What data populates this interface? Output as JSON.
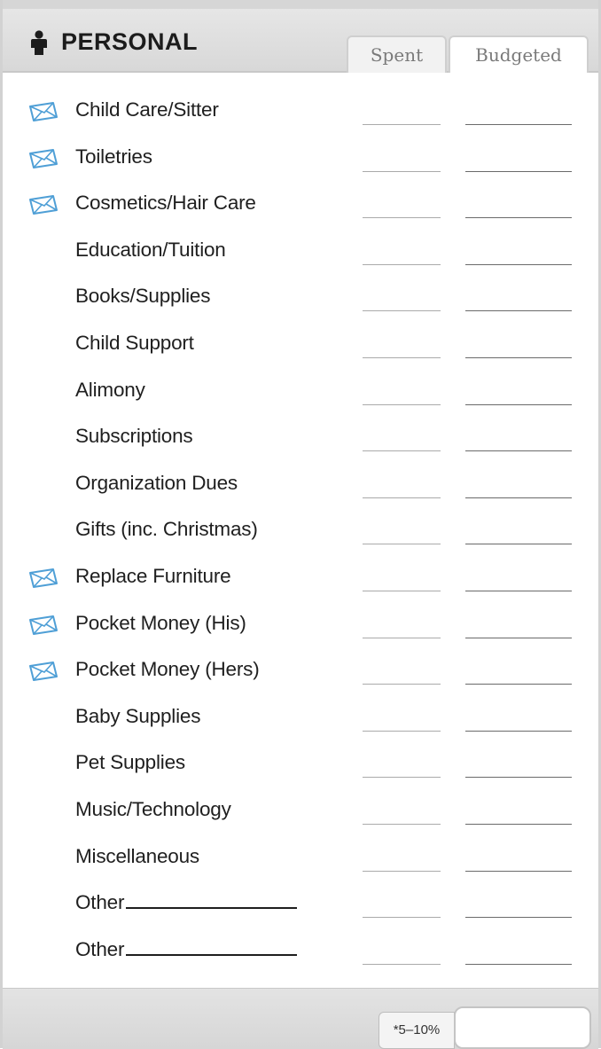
{
  "section": {
    "title": "PERSONAL",
    "icon": "person-icon"
  },
  "tabs": {
    "spent": "Spent",
    "budgeted": "Budgeted"
  },
  "items": [
    {
      "label": "Child Care/Sitter",
      "envelope": true
    },
    {
      "label": "Toiletries",
      "envelope": true
    },
    {
      "label": "Cosmetics/Hair Care",
      "envelope": true
    },
    {
      "label": "Education/Tuition",
      "envelope": false
    },
    {
      "label": "Books/Supplies",
      "envelope": false
    },
    {
      "label": "Child Support",
      "envelope": false
    },
    {
      "label": "Alimony",
      "envelope": false
    },
    {
      "label": "Subscriptions",
      "envelope": false
    },
    {
      "label": "Organization Dues",
      "envelope": false
    },
    {
      "label": "Gifts (inc. Christmas)",
      "envelope": false
    },
    {
      "label": "Replace Furniture",
      "envelope": true
    },
    {
      "label": "Pocket Money (His)",
      "envelope": true
    },
    {
      "label": "Pocket Money (Hers)",
      "envelope": true
    },
    {
      "label": "Baby Supplies",
      "envelope": false
    },
    {
      "label": "Pet Supplies",
      "envelope": false
    },
    {
      "label": "Music/Technology",
      "envelope": false
    },
    {
      "label": "Miscellaneous",
      "envelope": false
    },
    {
      "label": "Other",
      "envelope": false,
      "blank": true
    },
    {
      "label": "Other",
      "envelope": false,
      "blank": true
    }
  ],
  "footer": {
    "percentage": "*5–10%"
  },
  "colors": {
    "envelope": "#4f9fd6",
    "header_bg": "#dedede",
    "text": "#1e1e1e"
  }
}
